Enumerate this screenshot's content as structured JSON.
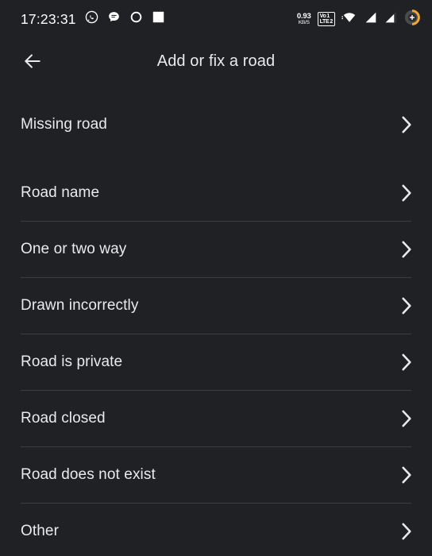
{
  "status_bar": {
    "time": "17:23:31",
    "left_icons": [
      {
        "name": "whatsapp-icon",
        "glyph": "whatsapp"
      },
      {
        "name": "messages-icon",
        "glyph": "chat-bubble"
      },
      {
        "name": "circle-app-icon",
        "glyph": "circle-outline"
      },
      {
        "name": "square-app-icon",
        "glyph": "square-filled"
      }
    ],
    "network_speed": {
      "value": "0.93",
      "unit": "KB/S"
    },
    "volte": {
      "line1": "Vo",
      "line1_sup": "1",
      "line2": "LTE",
      "line2_sup": "2"
    },
    "right_icons": [
      {
        "name": "wifi-icon"
      },
      {
        "name": "signal-sim1-icon"
      },
      {
        "name": "signal-sim2-icon"
      },
      {
        "name": "battery-charging-icon"
      }
    ]
  },
  "app_bar": {
    "back_label": "Back",
    "title": "Add or fix a road"
  },
  "colors": {
    "background": "#202124",
    "text_primary": "#e8eaed",
    "divider": "#3b3d40",
    "highlight": "#f50f5a",
    "battery_accent": "#f0a830"
  },
  "list": {
    "items": [
      {
        "label": "Missing road",
        "highlighted": true
      },
      {
        "label": "Road name",
        "highlighted": false
      },
      {
        "label": "One or two way",
        "highlighted": false
      },
      {
        "label": "Drawn incorrectly",
        "highlighted": false
      },
      {
        "label": "Road is private",
        "highlighted": false
      },
      {
        "label": "Road closed",
        "highlighted": false
      },
      {
        "label": "Road does not exist",
        "highlighted": false
      },
      {
        "label": "Other",
        "highlighted": false
      }
    ]
  }
}
